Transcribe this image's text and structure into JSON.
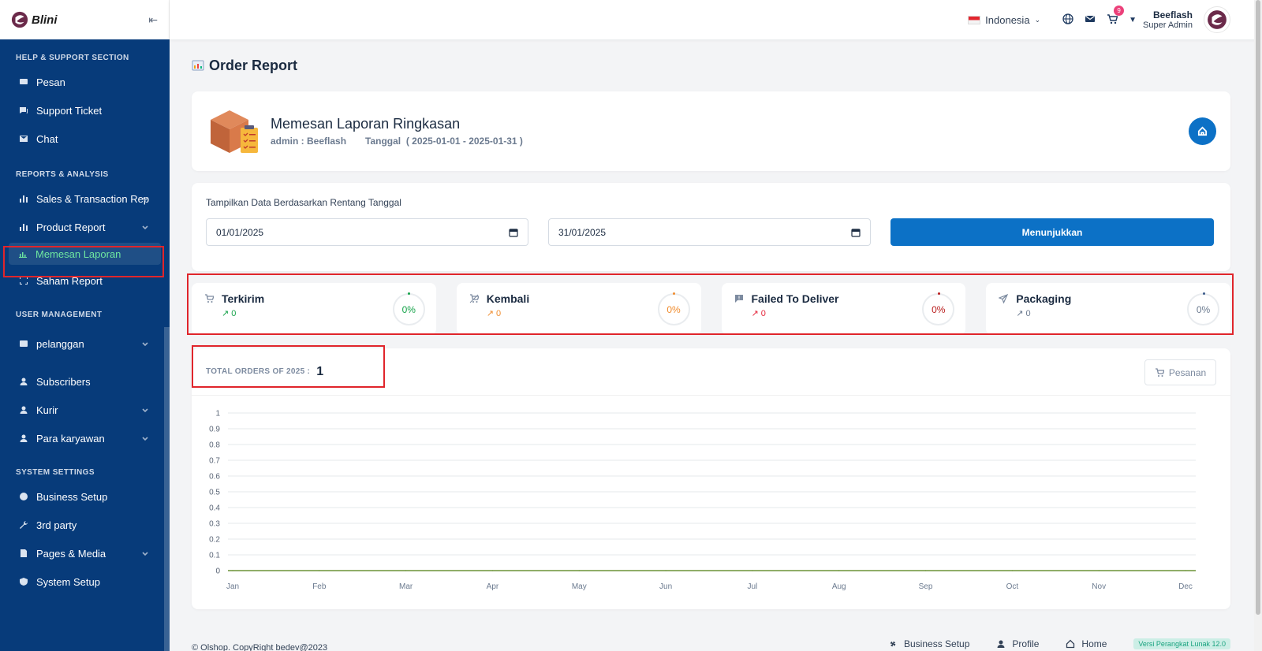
{
  "brand": {
    "name": "Blini"
  },
  "sidebar": {
    "sections": [
      {
        "title": "HELP & SUPPORT SECTION",
        "items": [
          {
            "label": "Pesan",
            "icon": "message-icon"
          },
          {
            "label": "Support Ticket",
            "icon": "ticket-icon"
          },
          {
            "label": "Chat",
            "icon": "chat-icon"
          }
        ]
      },
      {
        "title": "REPORTS & ANALYSIS",
        "items": [
          {
            "label": "Sales & Transaction Rep",
            "icon": "bar-chart-icon",
            "has_submenu": true
          },
          {
            "label": "Product Report",
            "icon": "bar-chart-icon",
            "has_submenu": true
          },
          {
            "label": "Memesan Laporan",
            "icon": "report-icon",
            "active": true
          },
          {
            "label": "Saham Report",
            "icon": "expand-icon"
          }
        ]
      },
      {
        "title": "USER MANAGEMENT",
        "items": [
          {
            "label": "pelanggan",
            "icon": "customer-icon",
            "has_submenu": true
          },
          {
            "label": "Subscribers",
            "icon": "person-icon"
          },
          {
            "label": "Kurir",
            "icon": "person-icon",
            "has_submenu": true
          },
          {
            "label": "Para karyawan",
            "icon": "person-icon",
            "has_submenu": true
          }
        ]
      },
      {
        "title": "SYSTEM SETTINGS",
        "items": [
          {
            "label": "Business Setup",
            "icon": "globe-icon"
          },
          {
            "label": "3rd party",
            "icon": "wrench-icon"
          },
          {
            "label": "Pages & Media",
            "icon": "pages-icon",
            "has_submenu": true
          },
          {
            "label": "System Setup",
            "icon": "shield-icon"
          }
        ]
      }
    ]
  },
  "topbar": {
    "language": "Indonesia",
    "cart_count": "9",
    "user_name": "Beeflash",
    "user_role": "Super Admin"
  },
  "page": {
    "title": "Order Report",
    "summary": {
      "title": "Memesan Laporan Ringkasan",
      "admin": "admin : Beeflash",
      "date_label": "Tanggal",
      "date_range": "( 2025-01-01 - 2025-01-31 )"
    },
    "filter": {
      "label": "Tampilkan Data Berdasarkan Rentang Tanggal",
      "start_date": "01/01/2025",
      "end_date": "31/01/2025",
      "button": "Menunjukkan"
    },
    "stats": [
      {
        "label": "Terkirim",
        "value": "0",
        "percent": "0%",
        "color": "#16a34a",
        "icon": "cart-icon"
      },
      {
        "label": "Kembali",
        "value": "0",
        "percent": "0%",
        "color": "#f08c2e",
        "icon": "cart-remove-icon"
      },
      {
        "label": "Failed To Deliver",
        "value": "0",
        "percent": "0%",
        "color": "#e5263b",
        "icon": "alert-message-icon"
      },
      {
        "label": "Packaging",
        "value": "0",
        "percent": "0%",
        "color": "#6b7a8f",
        "icon": "plane-icon"
      }
    ],
    "chart_header": {
      "total_label": "TOTAL ORDERS OF 2025 :",
      "total_value": "1",
      "button": "Pesanan"
    }
  },
  "chart_data": {
    "type": "line",
    "categories": [
      "Jan",
      "Feb",
      "Mar",
      "Apr",
      "May",
      "Jun",
      "Jul",
      "Aug",
      "Sep",
      "Oct",
      "Nov",
      "Dec"
    ],
    "series": [
      {
        "values": [
          0,
          0,
          0,
          0,
          0,
          0,
          0,
          0,
          0,
          0,
          0,
          0
        ],
        "color": "#4d7c0f"
      }
    ],
    "yticks": [
      "0",
      "0.1",
      "0.2",
      "0.3",
      "0.4",
      "0.5",
      "0.6",
      "0.7",
      "0.8",
      "0.9",
      "1"
    ],
    "ylim": [
      0,
      1
    ],
    "grid": true
  },
  "footer": {
    "copyright": "© Olshop. CopyRight bedev@2023",
    "links": [
      "Business Setup",
      "Profile",
      "Home"
    ],
    "version": "Versi Perangkat Lunak 12.0"
  }
}
